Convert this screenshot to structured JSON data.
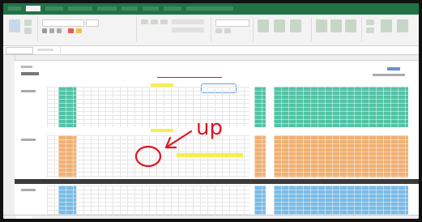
{
  "annotation": {
    "text": "up",
    "color": "#e0141e"
  },
  "colors": {
    "excel_green": "#217346",
    "teal_block": "#52c3a5",
    "orange_block": "#efb072",
    "blue_block": "#7bbce6",
    "highlight_yellow": "#f7ef4a",
    "dark_band": "#3b3b3b"
  },
  "icons": {
    "arrow": "arrow-icon",
    "circle_mark": "circle-annotation-icon"
  }
}
